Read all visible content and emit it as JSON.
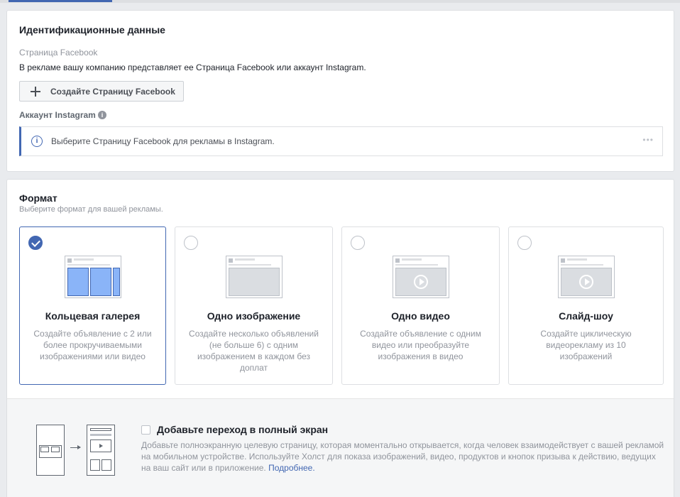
{
  "identity": {
    "title": "Идентификационные данные",
    "fb_page_label": "Страница Facebook",
    "fb_page_desc": "В рекламе вашу компанию представляет ее Страница Facebook или аккаунт Instagram.",
    "create_page_button": "Создайте Страницу Facebook",
    "instagram_label": "Аккаунт Instagram",
    "instagram_notice": "Выберите Страницу Facebook для рекламы в Instagram.",
    "more_dots": "•••"
  },
  "format": {
    "title": "Формат",
    "subtitle": "Выберите формат для вашей рекламы.",
    "options": [
      {
        "name": "Кольцевая галерея",
        "desc": "Создайте объявление с 2 или более прокручиваемыми изображениями или видео",
        "selected": true
      },
      {
        "name": "Одно изображение",
        "desc": "Создайте несколько объявлений (не больше 6) с одним изображением в каждом без доплат",
        "selected": false
      },
      {
        "name": "Одно видео",
        "desc": "Создайте объявление с одним видео или преобразуйте изображения в видео",
        "selected": false
      },
      {
        "name": "Слайд-шоу",
        "desc": "Создайте циклическую видеорекламу из 10 изображений",
        "selected": false
      }
    ]
  },
  "fullscreen": {
    "title": "Добавьте переход в полный экран",
    "desc": "Добавьте полноэкранную целевую страницу, которая моментально открывается, когда человек взаимодействует с вашей рекламой на мобильном устройстве. Используйте Холст для показа изображений, видео, продуктов и кнопок призыва к действию, ведущих на ваш сайт или в приложение.",
    "link": "Подробнее.",
    "checked": false
  },
  "colors": {
    "accent": "#4267b2",
    "background": "#e9ebee",
    "muted_text": "#90949c"
  }
}
